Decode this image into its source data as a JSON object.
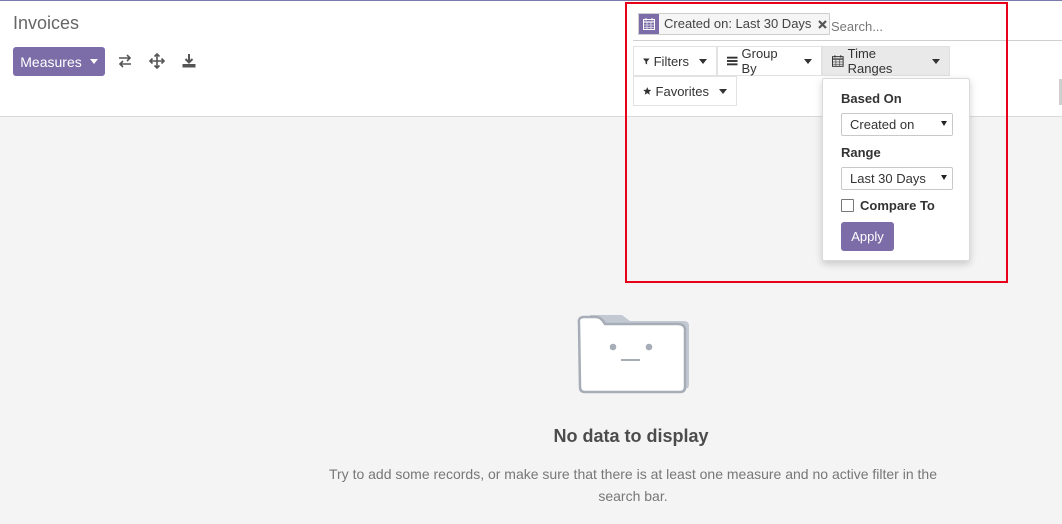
{
  "header": {
    "title": "Invoices",
    "measures_label": "Measures",
    "tool_icons": [
      "flip-axis-icon",
      "expand-all-icon",
      "download-icon"
    ]
  },
  "search": {
    "facet": {
      "icon": "calendar-icon",
      "label": "Created on: Last 30 Days",
      "remove_icon": "remove-icon"
    },
    "placeholder": "Search...",
    "buttons": {
      "filters": "Filters",
      "group_by": "Group By",
      "time_ranges": "Time Ranges",
      "favorites": "Favorites"
    }
  },
  "time_ranges_dropdown": {
    "based_on_label": "Based On",
    "based_on_value": "Created on",
    "range_label": "Range",
    "range_value": "Last 30 Days",
    "compare_label": "Compare To",
    "compare_checked": false,
    "apply_label": "Apply"
  },
  "empty_state": {
    "title": "No data to display",
    "text": "Try to add some records, or make sure that there is at least one measure and no active filter in the search bar."
  },
  "colors": {
    "primary": "#7c6ca8",
    "highlight": "#e8001a",
    "background": "#f4f4f4"
  }
}
